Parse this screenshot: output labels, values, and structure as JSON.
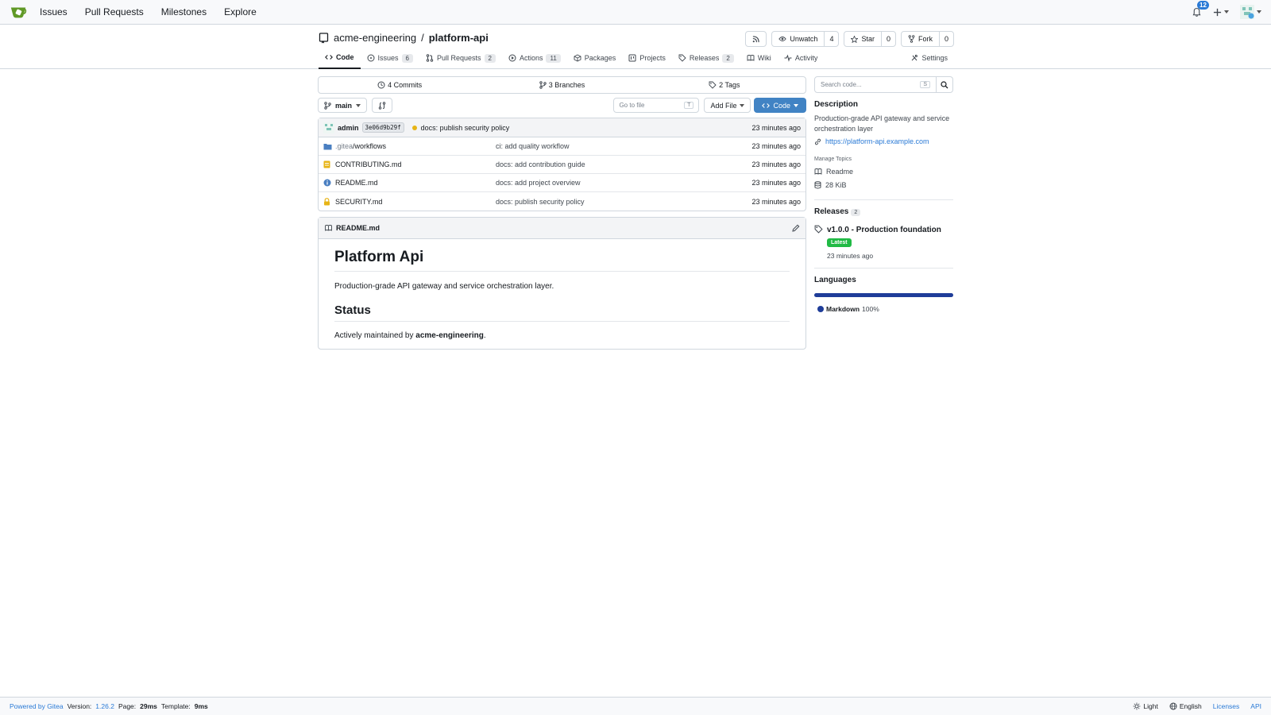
{
  "colors": {
    "accent": "#4183c4",
    "link": "#2a7ad6",
    "latest_badge": "#21ba45",
    "markdown_lang": "#1f3d99",
    "commit_status": "#e7b416"
  },
  "nav": {
    "links": [
      "Issues",
      "Pull Requests",
      "Milestones",
      "Explore"
    ],
    "notification_count": "12"
  },
  "repo": {
    "owner": "acme-engineering",
    "separator": "/",
    "name": "platform-api",
    "buttons": {
      "watch_label": "Unwatch",
      "watch_count": "4",
      "star_label": "Star",
      "star_count": "0",
      "fork_label": "Fork",
      "fork_count": "0"
    },
    "tabs": [
      {
        "label": "Code",
        "icon": "code-icon"
      },
      {
        "label": "Issues",
        "badge": "6",
        "icon": "issue-icon"
      },
      {
        "label": "Pull Requests",
        "badge": "2",
        "icon": "pull-request-icon"
      },
      {
        "label": "Actions",
        "badge": "11",
        "icon": "play-icon"
      },
      {
        "label": "Packages",
        "icon": "package-icon"
      },
      {
        "label": "Projects",
        "icon": "project-icon"
      },
      {
        "label": "Releases",
        "badge": "2",
        "icon": "tag-icon"
      },
      {
        "label": "Wiki",
        "icon": "book-icon"
      },
      {
        "label": "Activity",
        "icon": "pulse-icon"
      },
      {
        "label": "Settings",
        "icon": "tools-icon"
      }
    ]
  },
  "stats": {
    "commits": "4 Commits",
    "branches": "3 Branches",
    "tags": "2 Tags"
  },
  "toolbar": {
    "branch": "main",
    "goto_placeholder": "Go to file",
    "goto_key": "T",
    "add_file": "Add File",
    "code": "Code"
  },
  "latest_commit": {
    "author": "admin",
    "sha": "3e06d9b29f",
    "message": "docs: publish security policy",
    "time": "23 minutes ago"
  },
  "files": [
    {
      "prefix": ".gitea",
      "name": "/workflows",
      "message": "ci: add quality workflow",
      "time": "23 minutes ago",
      "icon": "folder-icon"
    },
    {
      "prefix": "",
      "name": "CONTRIBUTING.md",
      "message": "docs: add contribution guide",
      "time": "23 minutes ago",
      "icon": "file-icon"
    },
    {
      "prefix": "",
      "name": "README.md",
      "message": "docs: add project overview",
      "time": "23 minutes ago",
      "icon": "info-icon"
    },
    {
      "prefix": "",
      "name": "SECURITY.md",
      "message": "docs: publish security policy",
      "time": "23 minutes ago",
      "icon": "lock-icon"
    }
  ],
  "readme": {
    "filename": "README.md",
    "title": "Platform Api",
    "intro": "Production-grade API gateway and service orchestration layer.",
    "status_heading": "Status",
    "status_prefix": "Actively maintained by ",
    "status_owner": "acme-engineering",
    "status_suffix": "."
  },
  "sidebar": {
    "search_placeholder": "Search code...",
    "search_key": "S",
    "description_heading": "Description",
    "description": "Production-grade API gateway and service orchestration layer",
    "website": "https://platform-api.example.com",
    "manage_topics": "Manage Topics",
    "readme_label": "Readme",
    "size": "28  KiB",
    "releases_heading": "Releases",
    "releases_count": "2",
    "release_name": "v1.0.0 - Production foundation",
    "latest_badge": "Latest",
    "release_time": "23 minutes ago",
    "languages_heading": "Languages",
    "language_name": "Markdown",
    "language_pct": "100%",
    "language_fraction": 1.0
  },
  "footer": {
    "powered": "Powered by Gitea",
    "version_label": "Version:",
    "version": "1.26.2",
    "page_label": "Page:",
    "page_time": "29ms",
    "template_label": "Template:",
    "template_time": "9ms",
    "theme": "Light",
    "language": "English",
    "licenses": "Licenses",
    "api": "API"
  }
}
